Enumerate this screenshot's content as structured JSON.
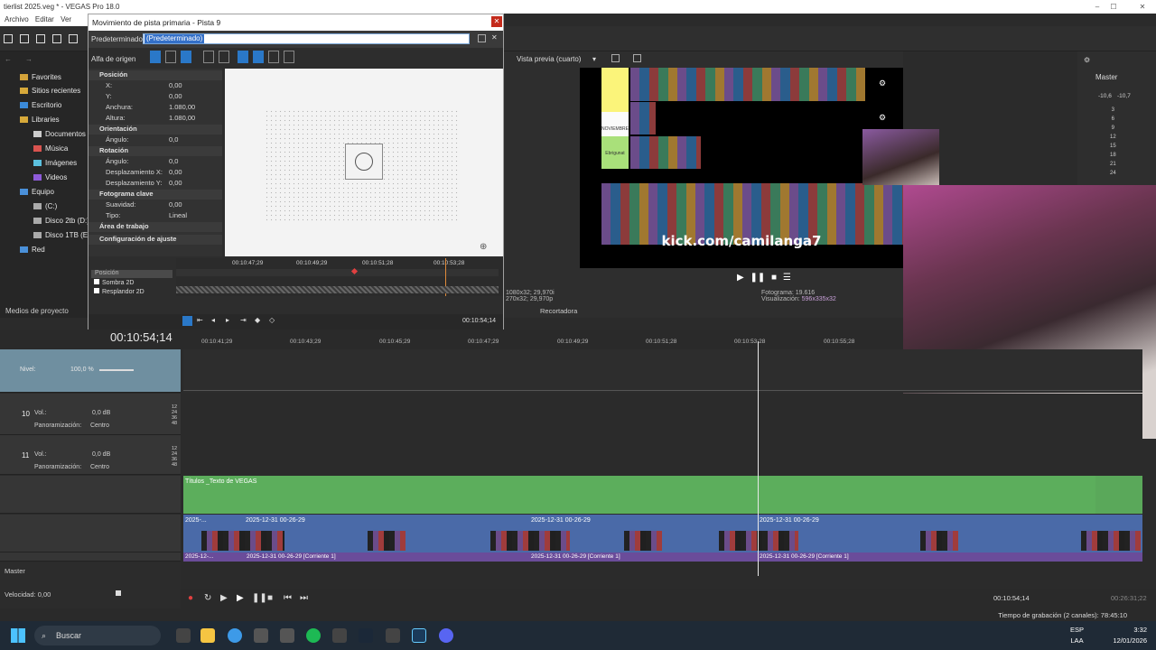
{
  "window": {
    "title": "tierlist 2025.veg * - VEGAS Pro 18.0",
    "min": "–",
    "max": "☐",
    "close": "✕"
  },
  "menu": [
    "Archivo",
    "Editar",
    "Ver"
  ],
  "explorer": {
    "items": [
      "Favorites",
      "Sitios recientes",
      "Escritorio",
      "Libraries",
      "Documentos",
      "Música",
      "Imágenes",
      "Videos",
      "Equipo",
      "(C:)",
      "Disco 2tb (D:)",
      "Disco 1TB (E:)",
      "Red"
    ],
    "tab": "Medios de proyecto"
  },
  "dialog": {
    "title": "Movimiento de pista primaria - Pista 9",
    "preset_label": "Predeterminado:",
    "preset_value": "(Predeterminado)",
    "origin_label": "Alfa de origen",
    "sections": {
      "position": "Posición",
      "orientation": "Orientación",
      "rotation": "Rotación",
      "keyframe": "Fotograma clave",
      "workarea": "Área de trabajo",
      "snap": "Configuración de ajuste"
    },
    "props": {
      "x_k": "X:",
      "x_v": "0,00",
      "y_k": "Y:",
      "y_v": "0,00",
      "w_k": "Anchura:",
      "w_v": "1.080,00",
      "h_k": "Altura:",
      "h_v": "1.080,00",
      "oa_k": "Ángulo:",
      "oa_v": "0,0",
      "ra_k": "Ángulo:",
      "ra_v": "0,0",
      "dx_k": "Desplazamiento X:",
      "dx_v": "0,00",
      "dy_k": "Desplazamiento Y:",
      "dy_v": "0,00",
      "sm_k": "Suavidad:",
      "sm_v": "0,00",
      "ty_k": "Tipo:",
      "ty_v": "Lineal"
    },
    "kf_list": [
      "Posición",
      "Sombra 2D",
      "Resplandor 2D"
    ],
    "kf_ruler": [
      "00:10:47;29",
      "00:10:49;29",
      "00:10:51;28",
      "00:10:53;28"
    ],
    "kf_time": "00:10:54;14"
  },
  "preview": {
    "label": "Vista previa (cuarto)",
    "tiers": [
      "",
      "NOVIEMBRE",
      "Ebrigunat"
    ],
    "banner": "kick.com/camilanga7",
    "info_left1": "1080x32; 29,970i",
    "info_left2": "270x32; 29,970p",
    "frame_label": "Fotograma:",
    "frame_val": "19.616",
    "vis_label": "Visualización:",
    "vis_val": "596x335x32",
    "tab": "Recortadora"
  },
  "master": {
    "label": "Master",
    "db1": "-10,6",
    "db2": "-10,7",
    "scale": [
      "3",
      "6",
      "9",
      "12",
      "15",
      "18",
      "21",
      "24"
    ]
  },
  "timeline": {
    "time": "00:10:54;14",
    "ruler": [
      "00:10:41;29",
      "00:10:43;29",
      "00:10:45;29",
      "00:10:47;29",
      "00:10:49;29",
      "00:10:51;28",
      "00:10:53;28",
      "00:10:55;28"
    ],
    "level_label": "Nivel:",
    "level_val": "100,0 %",
    "track10": {
      "num": "10",
      "vol_label": "Vol.:",
      "vol_val": "0,0 dB",
      "pan_label": "Panoramización:",
      "pan_val": "Centro"
    },
    "track11": {
      "num": "11",
      "vol_label": "Vol.:",
      "vol_val": "0,0 dB",
      "pan_label": "Panoramización:",
      "pan_val": "Centro"
    },
    "meter_scale": [
      "12",
      "24",
      "36",
      "48"
    ],
    "text_clip": "Títulos _Texto de VEGAS",
    "video_clips": [
      "2025-...",
      "2025-12-31 00-26-29",
      "2025-12-31 00-26-29",
      "2025-12-31 00-26-29"
    ],
    "audio_clips": [
      "2025-12-...",
      "2025-12-31 00-26-29 [Corriente 1]",
      "2025-12-31 00-26-29 [Corriente 1]",
      "2025-12-31 00-26-29 [Corriente 1]"
    ],
    "master_label": "Master",
    "speed_label": "Velocidad: 0,00",
    "cursor_time": "00:10:54;14",
    "end_time": "00:26:31;22"
  },
  "status": {
    "record": "Tiempo de grabación (2 canales): 78:45:10"
  },
  "taskbar": {
    "search": "Buscar",
    "lang1": "ESP",
    "lang2": "LAA",
    "time": "3:32",
    "date": "12/01/2026"
  }
}
